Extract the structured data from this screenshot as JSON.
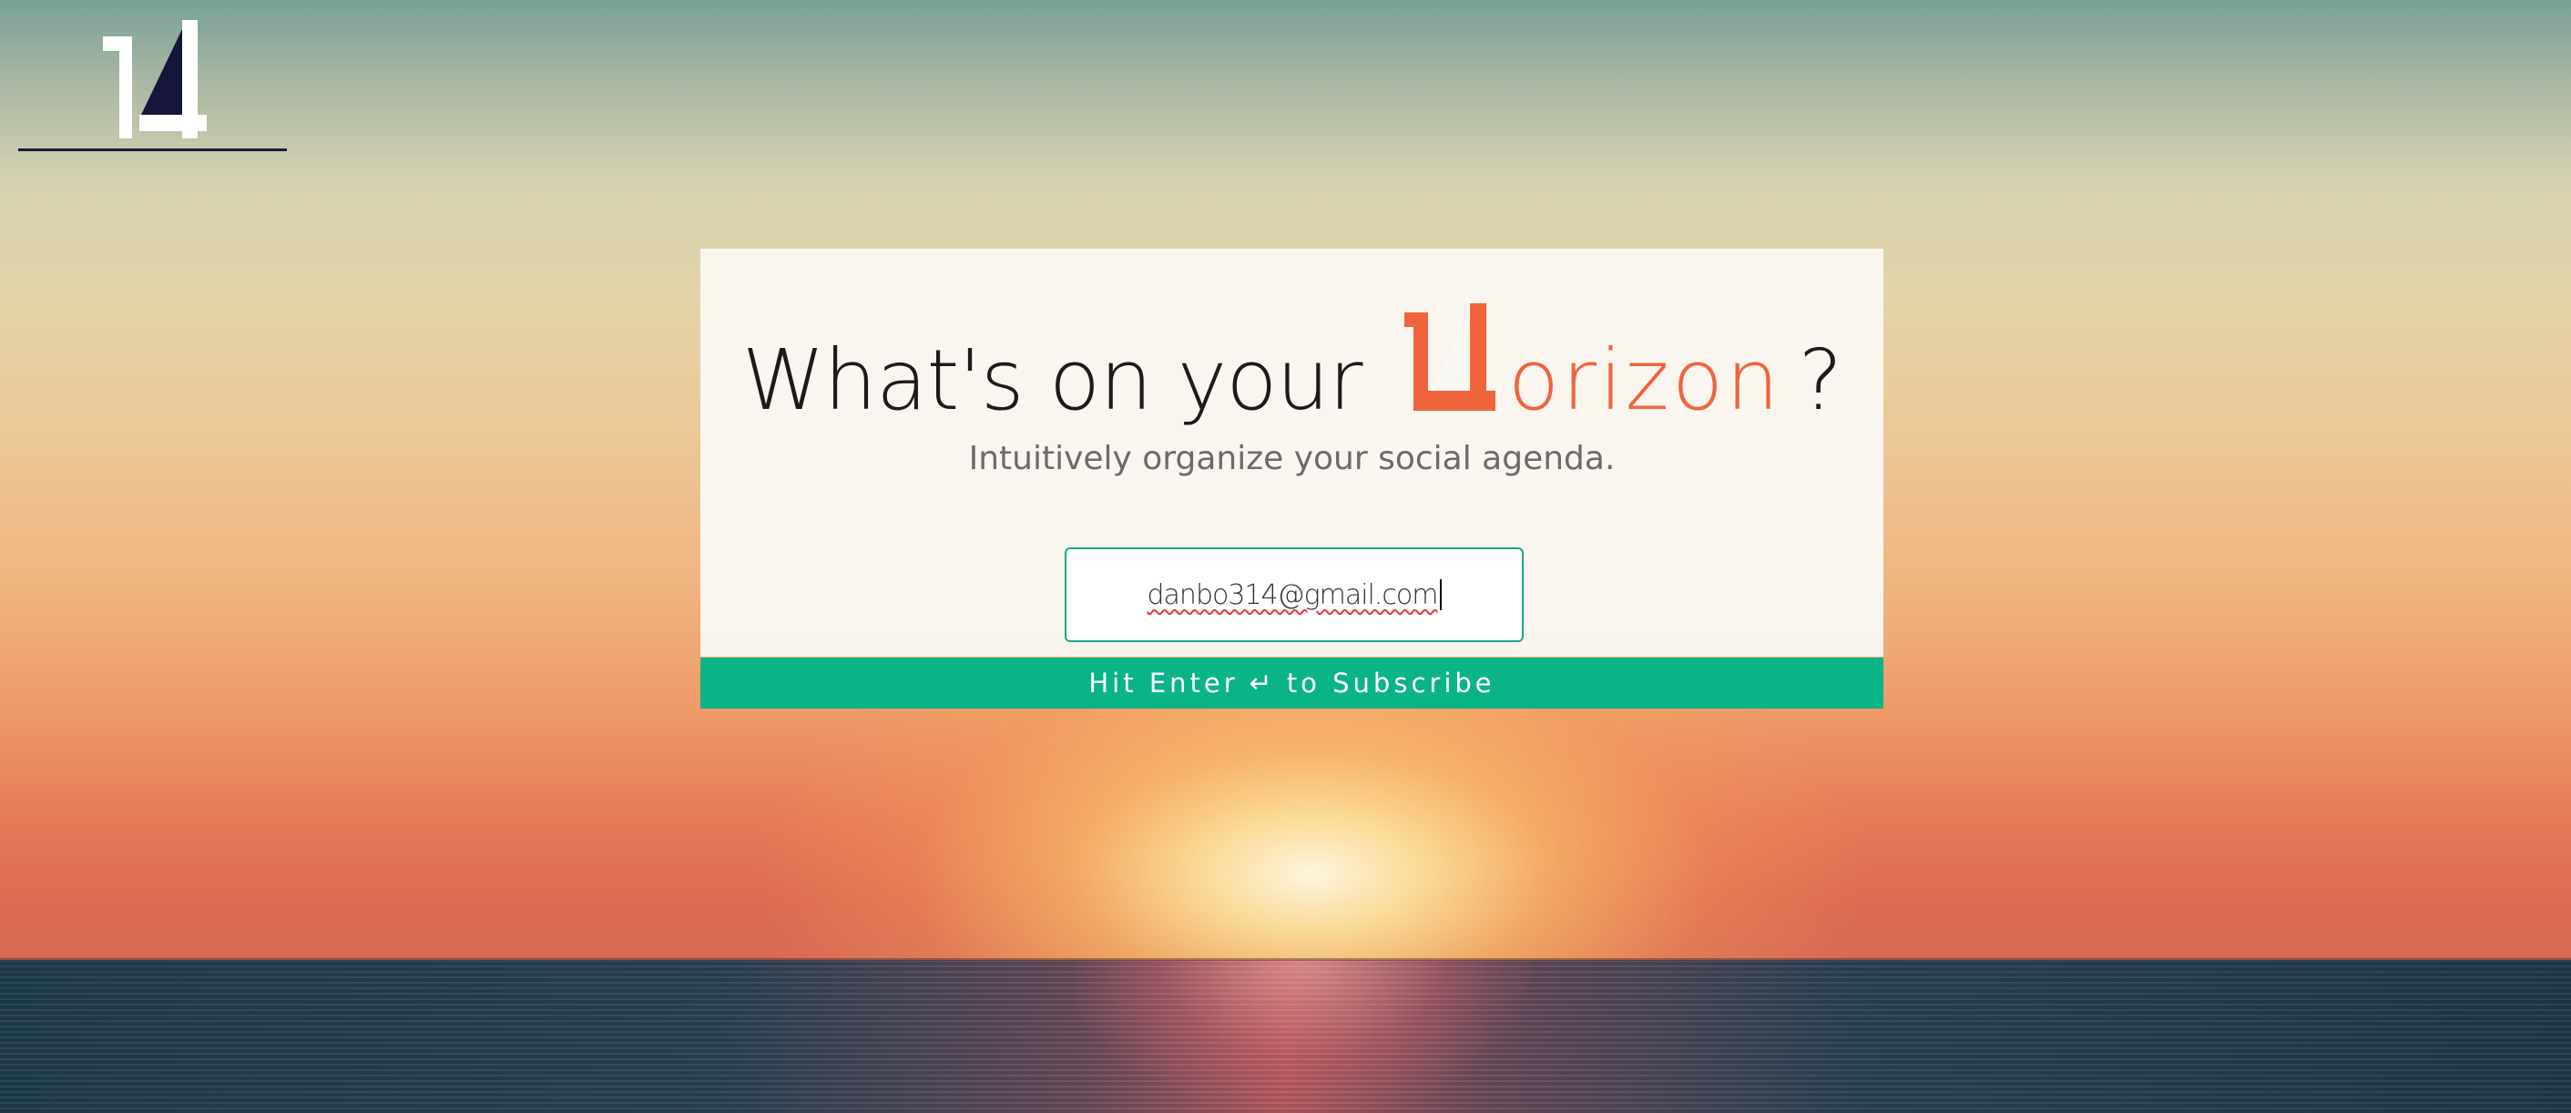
{
  "brand": {
    "logo_mark": "14",
    "logo_icon": "horizon-14-logo"
  },
  "hero": {
    "headline_prefix": "What's on your",
    "headline_brand_suffix": "orizon",
    "headline_question": "?",
    "subtitle": "Intuitively organize your social agenda."
  },
  "signup": {
    "email_value": "danbo314@gmail.com",
    "cta_before": "Hit Enter",
    "cta_glyph": "↵",
    "cta_after": "to Subscribe"
  },
  "colors": {
    "accent_orange": "#f0643c",
    "accent_green": "#0bb487",
    "logo_dark": "#1a1a3a"
  }
}
